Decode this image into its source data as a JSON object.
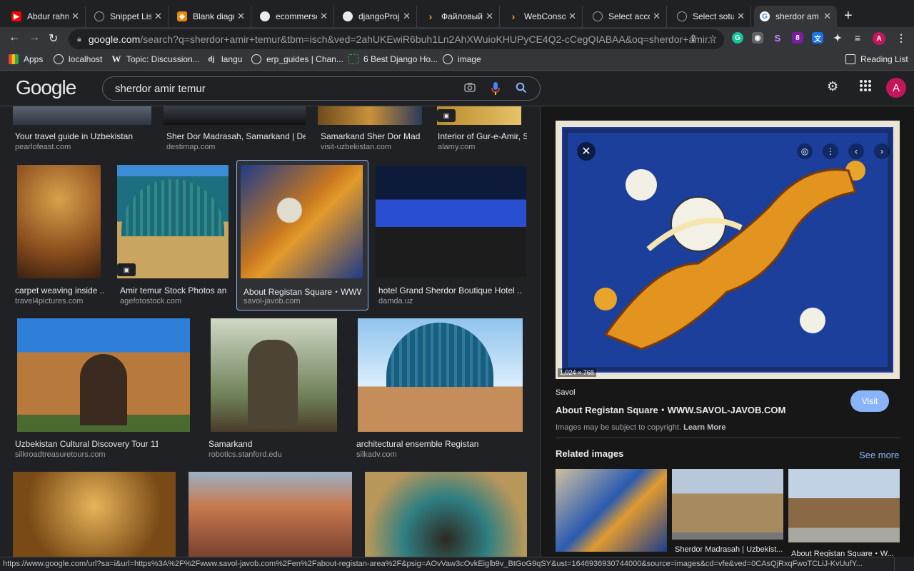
{
  "browser": {
    "tabs": [
      {
        "label": "Abdur rahm",
        "icon": "youtube-icon",
        "color": "#ff0000"
      },
      {
        "label": "Snippet List",
        "icon": "globe-icon",
        "color": "#9aa0a6"
      },
      {
        "label": "Blank diagra",
        "icon": "drawio-icon",
        "color": "#f08705"
      },
      {
        "label": "ecommerse",
        "icon": "github-icon",
        "color": "#e8eaed"
      },
      {
        "label": "djangoProje",
        "icon": "github-icon",
        "color": "#e8eaed"
      },
      {
        "label": "Файловый",
        "icon": "arrow-icon",
        "color": "#f9ab00"
      },
      {
        "label": "WebConsole",
        "icon": "arrow-icon",
        "color": "#f9ab00"
      },
      {
        "label": "Select acco",
        "icon": "globe-icon",
        "color": "#9aa0a6"
      },
      {
        "label": "Select sotu",
        "icon": "globe-icon",
        "color": "#9aa0a6"
      },
      {
        "label": "sherdor am",
        "icon": "google-icon",
        "color": "#4285f4"
      }
    ],
    "url_host": "google.com",
    "url_path": "/search?q=sherdor+amir+temur&tbm=isch&ved=2ahUKEwiR6buh1Ln2AhXWuioKHUPyCE4Q2-cCegQIABAA&oq=sherdor+amir...",
    "extension_badge": "8",
    "profile_letter": "A",
    "bookmarks": [
      {
        "label": "Apps",
        "icon": "apps-grid-icon"
      },
      {
        "label": "localhost",
        "icon": "globe-icon"
      },
      {
        "label": "Topic: Discussion...",
        "icon": "wikipedia-icon"
      },
      {
        "label": "langu",
        "icon": "django-icon"
      },
      {
        "label": "erp_guides | Chan...",
        "icon": "globe-icon"
      },
      {
        "label": "6 Best Django Ho...",
        "icon": "loading-icon"
      },
      {
        "label": "image",
        "icon": "globe-icon"
      }
    ],
    "reading_list": "Reading List",
    "status_url": "https://www.google.com/url?sa=i&url=https%3A%2F%2Fwww.savol-javob.com%2Fen%2Fabout-registan-area%2F&psig=AOvVaw3cOvkEiglb9v_BtGoG9qSY&ust=1646936930744000&source=images&cd=vfe&ved=0CAsQjRxqFwoTCLiJ-KvUufY..."
  },
  "google": {
    "logo": "Google",
    "query": "sherdor amir temur",
    "avatar_letter": "A"
  },
  "results": [
    {
      "caption": "Your travel guide in Uzbekistan",
      "source": "pearlofeast.com"
    },
    {
      "caption": "Sher Dor Madrasah, Samarkand | Des...",
      "source": "destimap.com"
    },
    {
      "caption": "Samarkand Sher Dor Madr...",
      "source": "visit-uzbekistan.com"
    },
    {
      "caption": "Interior of Gur-e-Amir, S...",
      "source": "alamy.com"
    },
    {
      "caption": "carpet weaving inside ...",
      "source": "travel4pictures.com"
    },
    {
      "caption": "Amir temur Stock Photos an...",
      "source": "agefotostock.com"
    },
    {
      "caption": "About Registan Square・WWW....",
      "source": "savol-javob.com"
    },
    {
      "caption": "hotel Grand Sherdor Boutique Hotel ...",
      "source": "damda.uz"
    },
    {
      "caption": "Uzbekistan Cultural Discovery Tour 11 ...",
      "source": "silkroadtreasuretours.com"
    },
    {
      "caption": "Samarkand",
      "source": "robotics.stanford.edu"
    },
    {
      "caption": "architectural ensemble Registan",
      "source": "silkadv.com"
    }
  ],
  "panel": {
    "dimensions": "1,024 × 768",
    "source": "Savol",
    "title": "About Registan Square・WWW.SAVOL-JAVOB.COM",
    "visit": "Visit",
    "copyright": "Images may be subject to copyright.",
    "learn_more": "Learn More",
    "related_title": "Related images",
    "see_more": "See more",
    "related": [
      {
        "caption": ""
      },
      {
        "caption": "Sherdor Madrasah | Uzbekist..."
      },
      {
        "caption": "About Registan Square・W..."
      }
    ]
  }
}
